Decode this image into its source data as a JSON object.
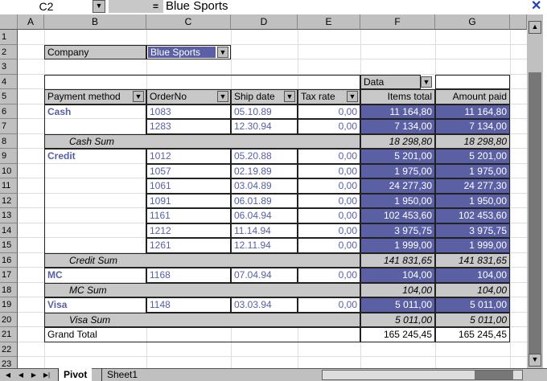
{
  "formula_bar": {
    "cell_ref": "C2",
    "equals": "=",
    "value": "Blue Sports"
  },
  "columns": [
    "A",
    "B",
    "C",
    "D",
    "E",
    "F",
    "G"
  ],
  "row_numbers": [
    "1",
    "2",
    "3",
    "4",
    "5",
    "6",
    "7",
    "8",
    "9",
    "10",
    "11",
    "12",
    "13",
    "14",
    "15",
    "16",
    "17",
    "18",
    "19",
    "20",
    "21",
    "22",
    "23"
  ],
  "page_field": {
    "label": "Company",
    "value": "Blue Sports"
  },
  "data_field": {
    "label": "Data"
  },
  "headers": {
    "payment": "Payment method",
    "order": "OrderNo",
    "ship": "Ship date",
    "tax": "Tax rate",
    "items": "Items total",
    "amount": "Amount paid"
  },
  "rows": [
    {
      "type": "item",
      "group": "Cash",
      "order": "1083",
      "ship": "05.10.89",
      "tax": "0,00",
      "items": "11 164,80",
      "amount": "11 164,80"
    },
    {
      "type": "item",
      "order": "1283",
      "ship": "12.30.94",
      "tax": "0,00",
      "items": "7 134,00",
      "amount": "7 134,00"
    },
    {
      "type": "sum",
      "label": "Cash Sum",
      "items": "18 298,80",
      "amount": "18 298,80"
    },
    {
      "type": "item",
      "group": "Credit",
      "order": "1012",
      "ship": "05.20.88",
      "tax": "0,00",
      "items": "5 201,00",
      "amount": "5 201,00"
    },
    {
      "type": "item",
      "order": "1057",
      "ship": "02.19.89",
      "tax": "0,00",
      "items": "1 975,00",
      "amount": "1 975,00"
    },
    {
      "type": "item",
      "order": "1061",
      "ship": "03.04.89",
      "tax": "0,00",
      "items": "24 277,30",
      "amount": "24 277,30"
    },
    {
      "type": "item",
      "order": "1091",
      "ship": "06.01.89",
      "tax": "0,00",
      "items": "1 950,00",
      "amount": "1 950,00"
    },
    {
      "type": "item",
      "order": "1161",
      "ship": "06.04.94",
      "tax": "0,00",
      "items": "102 453,60",
      "amount": "102 453,60"
    },
    {
      "type": "item",
      "order": "1212",
      "ship": "11.14.94",
      "tax": "0,00",
      "items": "3 975,75",
      "amount": "3 975,75"
    },
    {
      "type": "item",
      "order": "1261",
      "ship": "12.11.94",
      "tax": "0,00",
      "items": "1 999,00",
      "amount": "1 999,00"
    },
    {
      "type": "sum",
      "label": "Credit Sum",
      "items": "141 831,65",
      "amount": "141 831,65"
    },
    {
      "type": "item",
      "group": "MC",
      "order": "1168",
      "ship": "07.04.94",
      "tax": "0,00",
      "items": "104,00",
      "amount": "104,00"
    },
    {
      "type": "sum",
      "label": "MC Sum",
      "items": "104,00",
      "amount": "104,00"
    },
    {
      "type": "item",
      "group": "Visa",
      "order": "1148",
      "ship": "03.03.94",
      "tax": "0,00",
      "items": "5 011,00",
      "amount": "5 011,00"
    },
    {
      "type": "sum",
      "label": "Visa Sum",
      "items": "5 011,00",
      "amount": "5 011,00"
    },
    {
      "type": "total",
      "label": "Grand Total",
      "items": "165 245,45",
      "amount": "165 245,45"
    }
  ],
  "sheet_tabs": [
    "Pivot",
    "Sheet1"
  ],
  "active_tab": "Pivot"
}
